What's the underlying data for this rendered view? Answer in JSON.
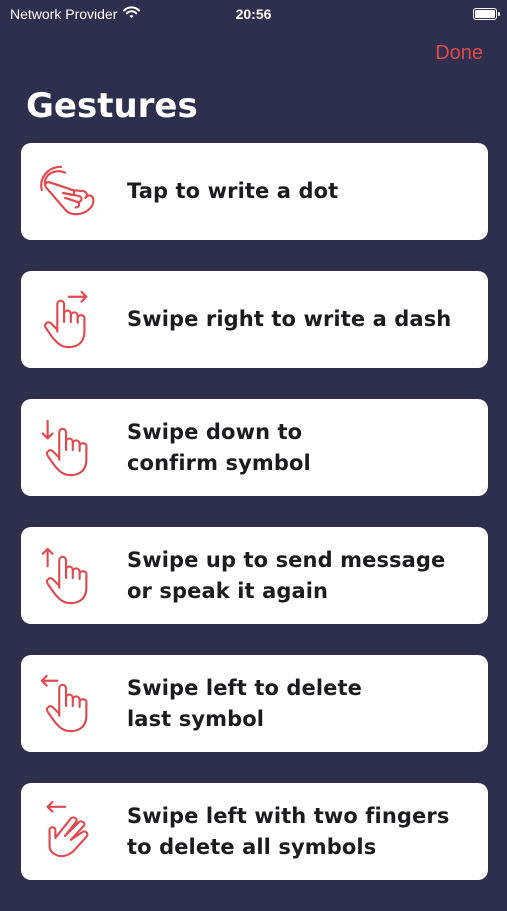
{
  "status": {
    "carrier": "Network Provider",
    "time": "20:56",
    "wifi_icon": "wifi-icon",
    "battery_icon": "battery-icon",
    "battery_level": 1.0
  },
  "nav": {
    "done_label": "Done"
  },
  "title": "Gestures",
  "accent_color": "#e0494f",
  "background_color": "#2e2f4d",
  "gestures": [
    {
      "icon": "tap-hand-icon",
      "label": "Tap to write a dot"
    },
    {
      "icon": "swipe-right-hand-icon",
      "label": "Swipe right to write a dash"
    },
    {
      "icon": "swipe-down-hand-icon",
      "label": "Swipe down to\nconfirm symbol"
    },
    {
      "icon": "swipe-up-hand-icon",
      "label": "Swipe up to send message\nor speak it again"
    },
    {
      "icon": "swipe-left-hand-icon",
      "label": "Swipe left to delete\nlast symbol"
    },
    {
      "icon": "two-finger-swipe-left-icon",
      "label": "Swipe left with two fingers\nto delete all symbols"
    }
  ]
}
